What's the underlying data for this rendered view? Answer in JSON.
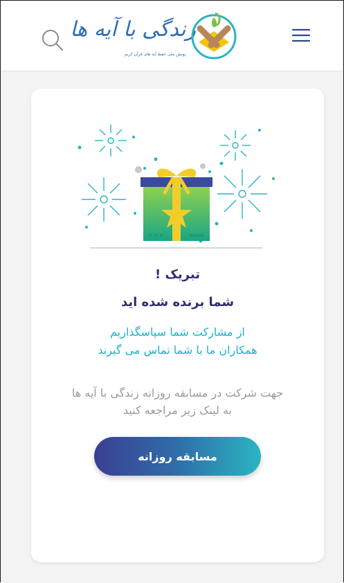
{
  "header": {
    "logo_title": "زندگی با آیه ها",
    "logo_subtitle": "پویش ملی حفظ آیه های قرآن کریم",
    "menu_icon": "hamburger-menu-icon",
    "search_icon": "search-icon"
  },
  "card": {
    "congrats": "تبریک !",
    "winner": "شما برنده شده اید",
    "thanks_line1": "از مشارکت شما سپاسگذاریم",
    "thanks_line2": "همکاران ما با شما تماس می گیرند",
    "info_line1": "جهت شرکت در مسابقه روزانه زندگی با آیه ها",
    "info_line2": "به لینک زیر مراجعه کنید",
    "cta_label": "مسابقه روزانه"
  },
  "colors": {
    "title": "#2f2f6d",
    "accent": "#1bb3c8",
    "muted": "#9a9a9a",
    "button_start": "#3b3f93",
    "button_end": "#2bb5c2"
  }
}
